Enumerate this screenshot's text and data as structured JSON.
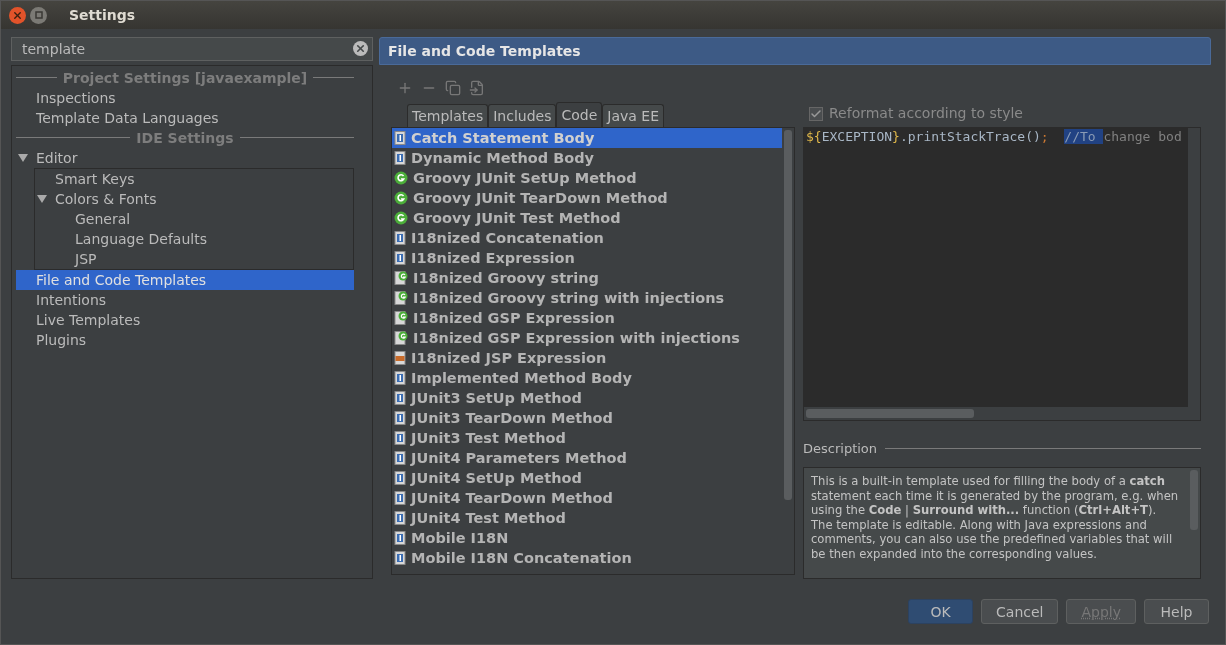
{
  "window": {
    "title": "Settings"
  },
  "search": {
    "value": "template"
  },
  "sidebar": {
    "sections": [
      {
        "title": "Project Settings [javaexample]",
        "items": [
          {
            "label": "Inspections",
            "selected": false
          },
          {
            "label": "Template Data Languages",
            "selected": false
          }
        ]
      },
      {
        "title": "IDE Settings",
        "items": [
          {
            "label": "Editor",
            "selected": false,
            "expanded": true,
            "children": [
              {
                "label": "Smart Keys",
                "selected": false
              },
              {
                "label": "Colors & Fonts",
                "selected": false,
                "expanded": true,
                "children": [
                  {
                    "label": "General",
                    "selected": false
                  },
                  {
                    "label": "Language Defaults",
                    "selected": false
                  },
                  {
                    "label": "JSP",
                    "selected": false
                  }
                ]
              }
            ]
          },
          {
            "label": "File and Code Templates",
            "selected": true
          },
          {
            "label": "Intentions",
            "selected": false
          },
          {
            "label": "Live Templates",
            "selected": false
          },
          {
            "label": "Plugins",
            "selected": false
          }
        ]
      }
    ]
  },
  "panel": {
    "title": "File and Code Templates",
    "tabs": [
      {
        "label": "Templates",
        "selected": false
      },
      {
        "label": "Includes",
        "selected": false
      },
      {
        "label": "Code",
        "selected": true
      },
      {
        "label": "Java EE",
        "selected": false
      }
    ],
    "templates": [
      {
        "label": "Catch Statement Body",
        "kind": "java",
        "selected": true
      },
      {
        "label": "Dynamic Method Body",
        "kind": "java",
        "selected": false
      },
      {
        "label": "Groovy JUnit SetUp Method",
        "kind": "groovy",
        "selected": false
      },
      {
        "label": "Groovy JUnit TearDown Method",
        "kind": "groovy",
        "selected": false
      },
      {
        "label": "Groovy JUnit Test Method",
        "kind": "groovy",
        "selected": false
      },
      {
        "label": "I18nized Concatenation",
        "kind": "java",
        "selected": false
      },
      {
        "label": "I18nized Expression",
        "kind": "java",
        "selected": false
      },
      {
        "label": "I18nized Groovy string",
        "kind": "groovyfile",
        "selected": false
      },
      {
        "label": "I18nized Groovy string with injections",
        "kind": "groovyfile",
        "selected": false
      },
      {
        "label": "I18nized GSP Expression",
        "kind": "groovyfile",
        "selected": false
      },
      {
        "label": "I18nized GSP Expression with injections",
        "kind": "groovyfile",
        "selected": false
      },
      {
        "label": "I18nized JSP Expression",
        "kind": "jsp",
        "selected": false
      },
      {
        "label": "Implemented Method Body",
        "kind": "java",
        "selected": false
      },
      {
        "label": "JUnit3 SetUp Method",
        "kind": "java",
        "selected": false
      },
      {
        "label": "JUnit3 TearDown Method",
        "kind": "java",
        "selected": false
      },
      {
        "label": "JUnit3 Test Method",
        "kind": "java",
        "selected": false
      },
      {
        "label": "JUnit4 Parameters Method",
        "kind": "java",
        "selected": false
      },
      {
        "label": "JUnit4 SetUp Method",
        "kind": "java",
        "selected": false
      },
      {
        "label": "JUnit4 TearDown Method",
        "kind": "java",
        "selected": false
      },
      {
        "label": "JUnit4 Test Method",
        "kind": "java",
        "selected": false
      },
      {
        "label": "Mobile I18N",
        "kind": "java",
        "selected": false
      },
      {
        "label": "Mobile I18N Concatenation",
        "kind": "java",
        "selected": false
      }
    ],
    "reformat": {
      "label": "Reformat according to style",
      "checked": true
    },
    "code": [
      {
        "text": "${",
        "kind": "brace"
      },
      {
        "text": "EXCEPTION",
        "kind": "var"
      },
      {
        "text": "}",
        "kind": "brace"
      },
      {
        "text": ".printStackTrace()",
        "kind": "plain"
      },
      {
        "text": ";  ",
        "kind": "semi"
      },
      {
        "text": "//To ",
        "kind": "selected"
      },
      {
        "text": "change bod",
        "kind": "comment"
      }
    ],
    "description_label": "Description",
    "description": [
      "This is a built-in template used for filling the body of a **catch** statement each time it is generated by the program, e.g. when using the **Code** | **Surround with...** function (**Ctrl+Alt+T**).",
      "The template is editable. Along with Java expressions and comments, you can also use the predefined variables that will be then expanded into the corresponding values."
    ]
  },
  "buttons": [
    {
      "label": "OK",
      "kind": "default",
      "disabled": false
    },
    {
      "label": "Cancel",
      "kind": "normal",
      "disabled": false
    },
    {
      "label": "Apply",
      "kind": "normal",
      "disabled": true
    },
    {
      "label": "Help",
      "kind": "normal",
      "disabled": false
    }
  ]
}
